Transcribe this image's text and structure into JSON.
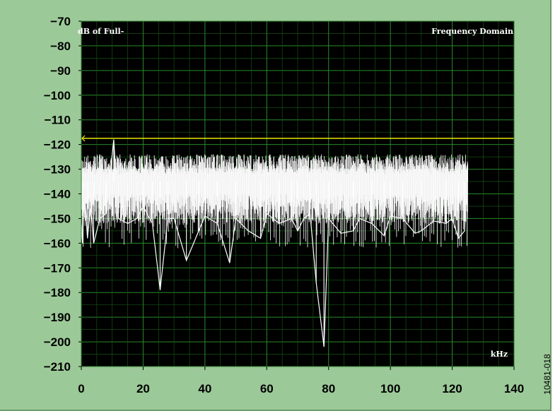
{
  "chart_data": {
    "type": "line",
    "title": "Frequency Domain",
    "ylabel": "dB of Full-",
    "xlabel": "kHz",
    "xlim": [
      0,
      140
    ],
    "ylim": [
      -210,
      -70
    ],
    "xticks": [
      "0",
      "20",
      "40",
      "60",
      "80",
      "100",
      "120",
      "140"
    ],
    "yticks": [
      "−70",
      "−80",
      "−90",
      "−100",
      "−110",
      "−120",
      "−130",
      "−140",
      "−150",
      "−160",
      "−170",
      "−180",
      "−190",
      "−200",
      "−210"
    ],
    "grid": true,
    "cursor_level": -117.5,
    "series": [
      {
        "x": [
          0,
          0.4,
          1,
          2,
          3,
          4,
          6,
          8,
          10.5,
          12,
          15,
          18,
          20,
          23,
          25.5,
          28,
          30,
          34,
          38,
          40,
          44,
          48,
          50,
          54,
          58,
          60,
          64,
          68,
          70,
          72,
          74,
          76,
          78.5,
          80,
          84,
          88,
          90,
          94,
          98,
          100,
          104,
          108,
          110,
          114,
          118,
          120,
          122,
          124,
          125
        ],
        "y": [
          -152,
          -160,
          -138,
          -158,
          -145,
          -160,
          -150,
          -148,
          -118,
          -150,
          -152,
          -150,
          -145,
          -152,
          -179,
          -150,
          -150,
          -167,
          -155,
          -149,
          -152,
          -168,
          -150,
          -155,
          -158,
          -148,
          -152,
          -150,
          -155,
          -150,
          -148,
          -176,
          -202,
          -150,
          -156,
          -155,
          -150,
          -152,
          -157,
          -149,
          -150,
          -156,
          -155,
          -151,
          -152,
          -150,
          -158,
          -155,
          -128
        ]
      }
    ]
  },
  "figure_id": "10481-018"
}
